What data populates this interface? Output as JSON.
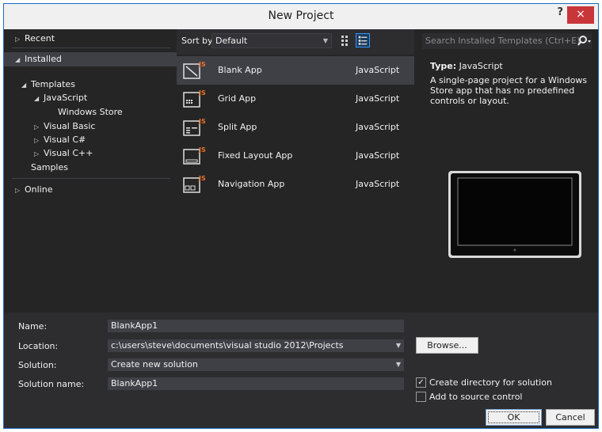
{
  "title": "New Project",
  "titlebar": {
    "help": "?",
    "close": "×"
  },
  "tree": {
    "recent": "Recent",
    "installed": "Installed",
    "templates": "Templates",
    "javascript": "JavaScript",
    "windows_store": "Windows Store",
    "visual_basic": "Visual Basic",
    "visual_csharp": "Visual C#",
    "visual_cpp": "Visual C++",
    "samples": "Samples",
    "online": "Online"
  },
  "toolbar": {
    "sort_label": "Sort by:",
    "sort_value": "Default"
  },
  "templates": [
    {
      "name": "Blank App",
      "language": "JavaScript",
      "icon": "blank-app-icon"
    },
    {
      "name": "Grid App",
      "language": "JavaScript",
      "icon": "grid-app-icon"
    },
    {
      "name": "Split App",
      "language": "JavaScript",
      "icon": "split-app-icon"
    },
    {
      "name": "Fixed Layout App",
      "language": "JavaScript",
      "icon": "fixed-layout-app-icon"
    },
    {
      "name": "Navigation App",
      "language": "JavaScript",
      "icon": "navigation-app-icon"
    }
  ],
  "details": {
    "search_placeholder": "Search Installed Templates (Ctrl+E)",
    "type_label": "Type:",
    "type_value": "JavaScript",
    "description": "A single-page project for a Windows Store app that has no predefined controls or layout."
  },
  "form": {
    "name_label": "Name:",
    "name_value": "BlankApp1",
    "location_label": "Location:",
    "location_value": "c:\\users\\steve\\documents\\visual studio 2012\\Projects",
    "solution_label": "Solution:",
    "solution_value": "Create new solution",
    "solution_name_label": "Solution name:",
    "solution_name_value": "BlankApp1",
    "browse": "Browse...",
    "create_directory": "Create directory for solution",
    "create_directory_checked": true,
    "add_source_control": "Add to source control",
    "add_source_control_checked": false,
    "ok": "OK",
    "cancel": "Cancel"
  },
  "colors": {
    "accent": "#3399ff",
    "close": "#c8363a",
    "js_badge": "#e8732a"
  }
}
